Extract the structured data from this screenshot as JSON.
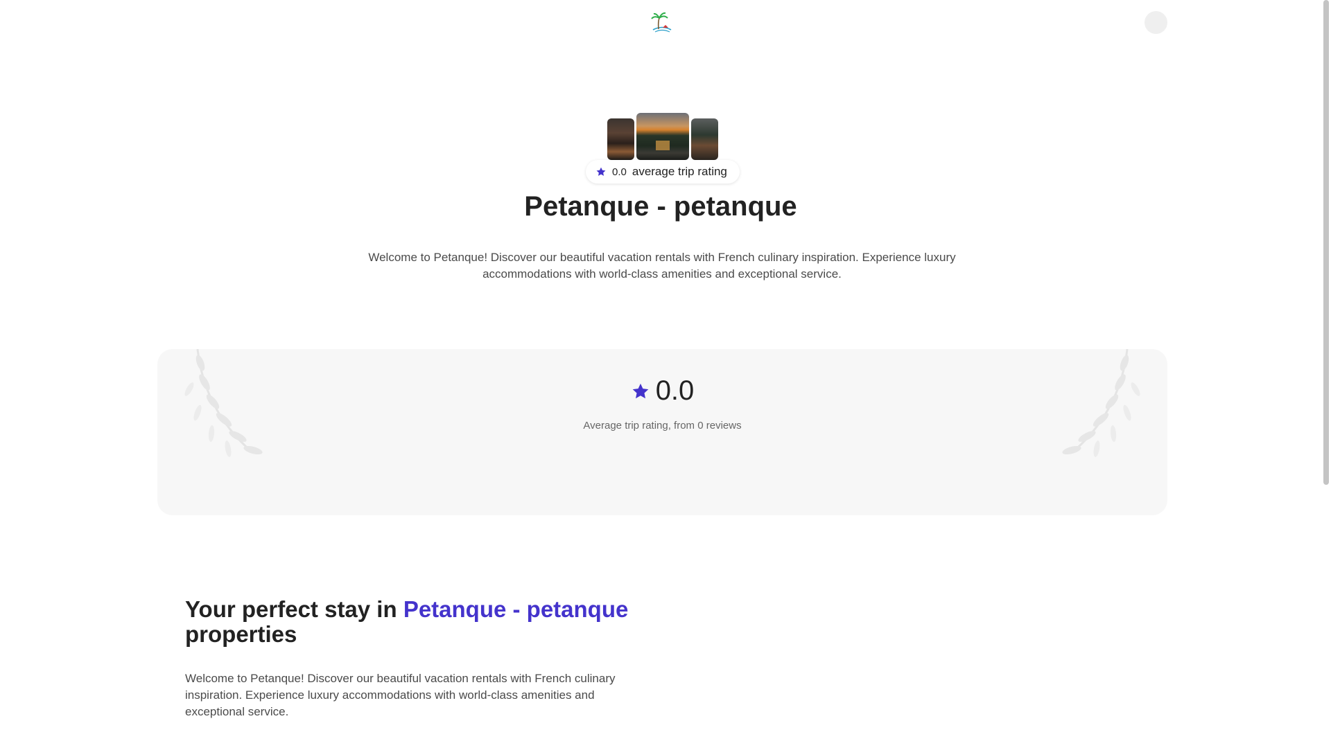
{
  "header": {
    "logo_icon": "palm-island-logo",
    "user_icon": "user-avatar"
  },
  "hero": {
    "rating_value": "0.0",
    "rating_label": "average trip rating",
    "title": "Petanque - petanque",
    "description": "Welcome to Petanque! Discover our beautiful vacation rentals with French culinary inspiration. Experience luxury accommodations with world-class amenities and exceptional service."
  },
  "rating_card": {
    "value": "0.0",
    "subtitle": "Average trip rating, from 0 reviews"
  },
  "stay_section": {
    "title_prefix": "Your perfect stay in ",
    "title_accent": "Petanque - petanque",
    "title_suffix": "properties",
    "description": "Welcome to Petanque! Discover our beautiful vacation rentals with French culinary inspiration. Experience luxury accommodations with world-class amenities and exceptional service."
  },
  "colors": {
    "accent": "#4433cc",
    "card_bg": "#f7f7f7",
    "text": "#222222"
  }
}
